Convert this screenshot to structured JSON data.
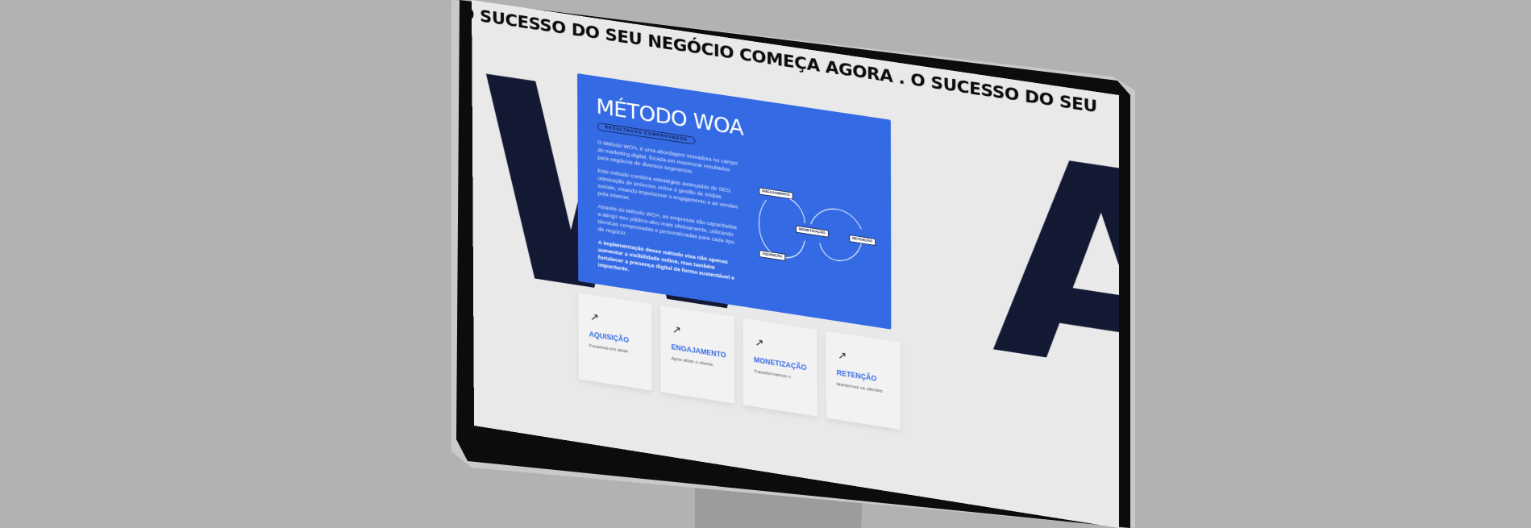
{
  "marquee": {
    "text": "O SUCESSO DO SEU NEGÓCIO COMEÇA AGORA  .  O SUCESSO DO SEU"
  },
  "hero": {
    "bg_letters_left": "W",
    "bg_letters_right": "A"
  },
  "method": {
    "title": "MÉTODO WOA",
    "badge": "RESULTADOS COMPROVADOS",
    "paragraphs": [
      "O Método WOA, é uma abordagem inovadora no campo do marketing digital, focada em maximizar resultados para negócios de diversos segmentos.",
      "Este método combina estratégias avançadas de SEO, otimização de anúncios online e gestão de mídias sociais, visando impulsionar o engajamento e as vendas pela internet.",
      "Através do Método WOA, as empresas são capacitadas a atingir seu público-alvo mais efetivamente, utilizando técnicas comprovadas e personalizadas para cada tipo de negócio."
    ],
    "closing": "A implementação desse método visa não apenas aumentar a visibilidade online, mas também fortalecer a presença digital de forma sustentável e impactante.",
    "diagram": {
      "engajamento": "ENGAJAMENTO",
      "monetizacao": "MONETIZAÇÃO",
      "retencao": "RETENÇÃO",
      "aquisicao": "AQUISIÇÃO"
    }
  },
  "features": [
    {
      "title": "AQUISIÇÃO",
      "text": "Focamos em atrair"
    },
    {
      "title": "ENGAJAMENTO",
      "text": "Após atrair o cliente,"
    },
    {
      "title": "MONETIZAÇÃO",
      "text": "Transformamos o"
    },
    {
      "title": "RETENÇÃO",
      "text": "Mantemos os clientes"
    }
  ],
  "colors": {
    "accent": "#346ae4",
    "dark": "#141933",
    "background": "#b2b2b2"
  }
}
